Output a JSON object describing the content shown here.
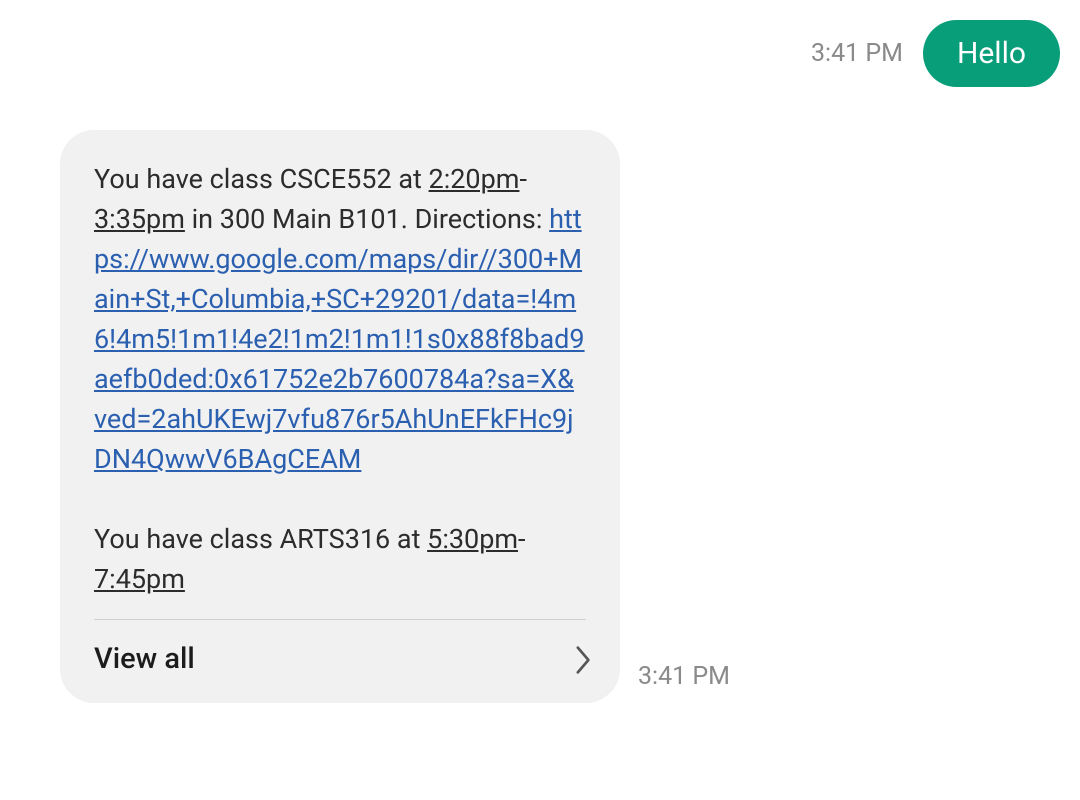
{
  "outgoing": {
    "text": "Hello",
    "time": "3:41 PM"
  },
  "incoming": {
    "time": "3:41 PM",
    "class1_prefix": "You have class CSCE552 at ",
    "class1_time": "2:20pm",
    "class1_dash": "-",
    "class1_time2": "3:35pm",
    "class1_loc": " in 300 Main B101. Directions: ",
    "link": "https://www.google.com/maps/dir//300+Main+St,+Columbia,+SC+29201/data=!4m6!4m5!1m1!4e2!1m2!1m1!1s0x88f8bad9aefb0ded:0x61752e2b7600784a?sa=X&ved=2ahUKEwj7vfu876r5AhUnEFkFHc9jDN4QwwV6BAgCEAM",
    "class2_prefix": "You have class ARTS316 at ",
    "class2_time": "5:30pm",
    "class2_dash": "-",
    "class2_time2": "7:45pm"
  },
  "view_all_label": "View all"
}
